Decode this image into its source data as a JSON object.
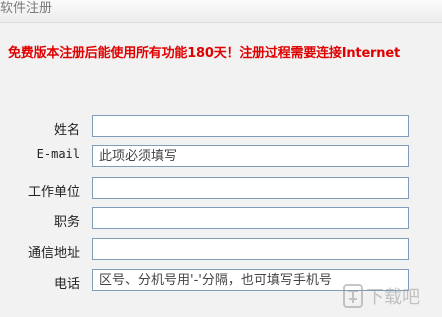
{
  "window": {
    "title": "软件注册"
  },
  "notice": "免费版本注册后能使用所有功能180天！注册过程需要连接Internet",
  "form": {
    "fields": [
      {
        "label": "姓名",
        "value": "",
        "placeholder": ""
      },
      {
        "label": "E-mail",
        "value": "",
        "placeholder": "此项必须填写"
      },
      {
        "label": "工作单位",
        "value": "",
        "placeholder": ""
      },
      {
        "label": "职务",
        "value": "",
        "placeholder": ""
      },
      {
        "label": "通信地址",
        "value": "",
        "placeholder": ""
      },
      {
        "label": "电话",
        "value": "",
        "placeholder": "区号、分机号用'-'分隔，也可填写手机号"
      }
    ]
  },
  "watermark": "下载吧"
}
